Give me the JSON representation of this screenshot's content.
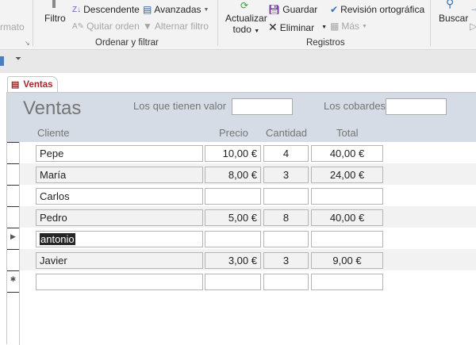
{
  "ribbon": {
    "formato_label": "rmato",
    "filtro": "Filtro",
    "descendente": "Descendente",
    "quitar_orden": "Quitar orden",
    "avanzadas": "Avanzadas",
    "alternar_filtro": "Alternar filtro",
    "group_ordenar": "Ordenar y filtrar",
    "actualizar": "Actualizar",
    "todo": "todo",
    "guardar": "Guardar",
    "eliminar": "Eliminar",
    "revision": "Revisión ortográfica",
    "mas": "Más",
    "group_registros": "Registros",
    "buscar": "Buscar"
  },
  "tab": {
    "label": "Ventas"
  },
  "form": {
    "title": "Ventas",
    "filter1_label": "Los que tienen valor",
    "filter1_value": "",
    "filter2_label": "Los cobardes",
    "filter2_value": "",
    "columns": [
      "Cliente",
      "Precio",
      "Cantidad",
      "Total"
    ],
    "rows": [
      {
        "cliente": "Pepe",
        "precio": "10,00 €",
        "cantidad": "4",
        "total": "40,00 €",
        "selector": ""
      },
      {
        "cliente": "María",
        "precio": "8,00 €",
        "cantidad": "3",
        "total": "24,00 €",
        "selector": ""
      },
      {
        "cliente": "Carlos",
        "precio": "",
        "cantidad": "",
        "total": "",
        "selector": ""
      },
      {
        "cliente": "Pedro",
        "precio": "5,00 €",
        "cantidad": "8",
        "total": "40,00 €",
        "selector": ""
      },
      {
        "cliente": "antonio",
        "precio": "",
        "cantidad": "",
        "total": "",
        "selector": "▶"
      },
      {
        "cliente": "Javier",
        "precio": "3,00 €",
        "cantidad": "3",
        "total": "9,00 €",
        "selector": ""
      },
      {
        "cliente": "",
        "precio": "",
        "cantidad": "",
        "total": "",
        "selector": "✱"
      }
    ]
  }
}
